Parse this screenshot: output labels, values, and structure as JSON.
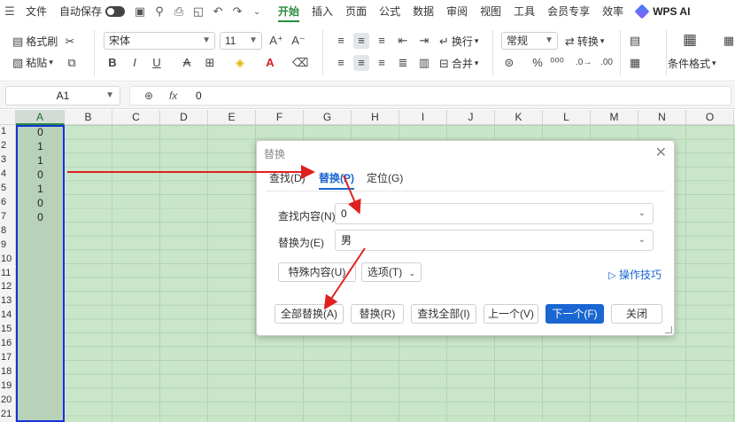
{
  "menu": {
    "file": "文件",
    "autosave": "自动保存",
    "tabs": [
      "开始",
      "插入",
      "页面",
      "公式",
      "数据",
      "审阅",
      "视图",
      "工具",
      "会员专享",
      "效率"
    ],
    "active_tab": "开始",
    "wps_ai": "WPS AI"
  },
  "ribbon": {
    "format_painter": "格式刷",
    "paste": "粘贴",
    "font_name": "宋体",
    "font_size": "11",
    "wrap": "换行",
    "merge": "合并",
    "number_format": "常规",
    "convert": "转换",
    "conditional_format": "条件格式"
  },
  "formula_bar": {
    "name_box": "A1",
    "fx": "fx",
    "value": "0"
  },
  "sheet": {
    "columns": [
      "A",
      "B",
      "C",
      "D",
      "E",
      "F",
      "G",
      "H",
      "I",
      "J",
      "K",
      "L",
      "M",
      "N",
      "O"
    ],
    "rows": [
      "1",
      "2",
      "3",
      "4",
      "5",
      "6",
      "7",
      "8",
      "9",
      "10",
      "11",
      "12",
      "13",
      "14",
      "15",
      "16",
      "17",
      "18",
      "19",
      "20",
      "21"
    ],
    "col_a_values": [
      "0",
      "1",
      "1",
      "0",
      "1",
      "0",
      "0"
    ]
  },
  "dialog": {
    "title": "替换",
    "tabs": [
      "查找(D)",
      "替换(P)",
      "定位(G)"
    ],
    "active_tab": "替换(P)",
    "find_label": "查找内容(N)",
    "find_value": "0",
    "replace_label": "替换为(E)",
    "replace_value": "男",
    "special_button": "特殊内容(U)",
    "options_button": "选项(T)",
    "tips_link": "操作技巧",
    "buttons": {
      "replace_all": "全部替换(A)",
      "replace": "替换(R)",
      "find_all": "查找全部(I)",
      "prev": "上一个(V)",
      "next": "下一个(F)",
      "close": "关闭"
    }
  },
  "colors": {
    "accent_green": "#2b8a3e",
    "selection_blue": "#1631d9",
    "primary_blue": "#1a66d2",
    "arrow_red": "#e02020",
    "sheet_green": "#c9e6c9"
  }
}
